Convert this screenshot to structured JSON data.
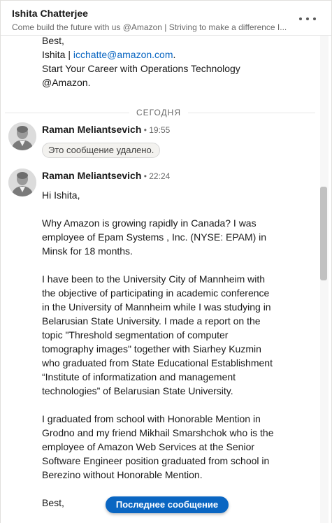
{
  "header": {
    "name": "Ishita Chatterjee",
    "headline": "Come build the future with us @Amazon | Striving to make a difference I...",
    "more_icon": "ellipsis-horizontal-icon"
  },
  "previous_message": {
    "closing": "Best,",
    "signature_name": "Ishita | ",
    "email": "icchatte@amazon.com",
    "email_suffix": ".",
    "tagline": "Start Your Career with Operations Technology\n@Amazon."
  },
  "divider": {
    "label": "СЕГОДНЯ"
  },
  "messages": [
    {
      "sender": "Raman Meliantsevich",
      "time": " • 19:55",
      "deleted_text": "Это сообщение удалено."
    },
    {
      "sender": "Raman Meliantsevich",
      "time": " • 22:24",
      "body": "Hi Ishita,\n\nWhy Amazon is growing rapidly in Canada? I was employee of Epam Systems , Inc. (NYSE: EPAM) in Minsk for 18 months.\n\nI have been to the University City of Mannheim with the objective of participating in academic conference in the University of Mannheim while I was studying in Belarusian State University. I made a report on the topic \"Threshold segmentation of computer tomography images\" together with Siarhey Kuzmin who graduated from State Educational Establishment “Institute of informatization and management technologies” of Belarusian State University.\n\nI graduated from school with Honorable Mention in Grodno and my friend Mikhail Smarshchok who is the employee of Amazon Web Services at the Senior Software Engineer position graduated from school in Berezino without Honorable Mention.\n\nBest,"
    }
  ],
  "jump_button": {
    "label": "Последнее сообщение"
  },
  "colors": {
    "link": "#0a66c2",
    "button": "#0a66c2"
  }
}
